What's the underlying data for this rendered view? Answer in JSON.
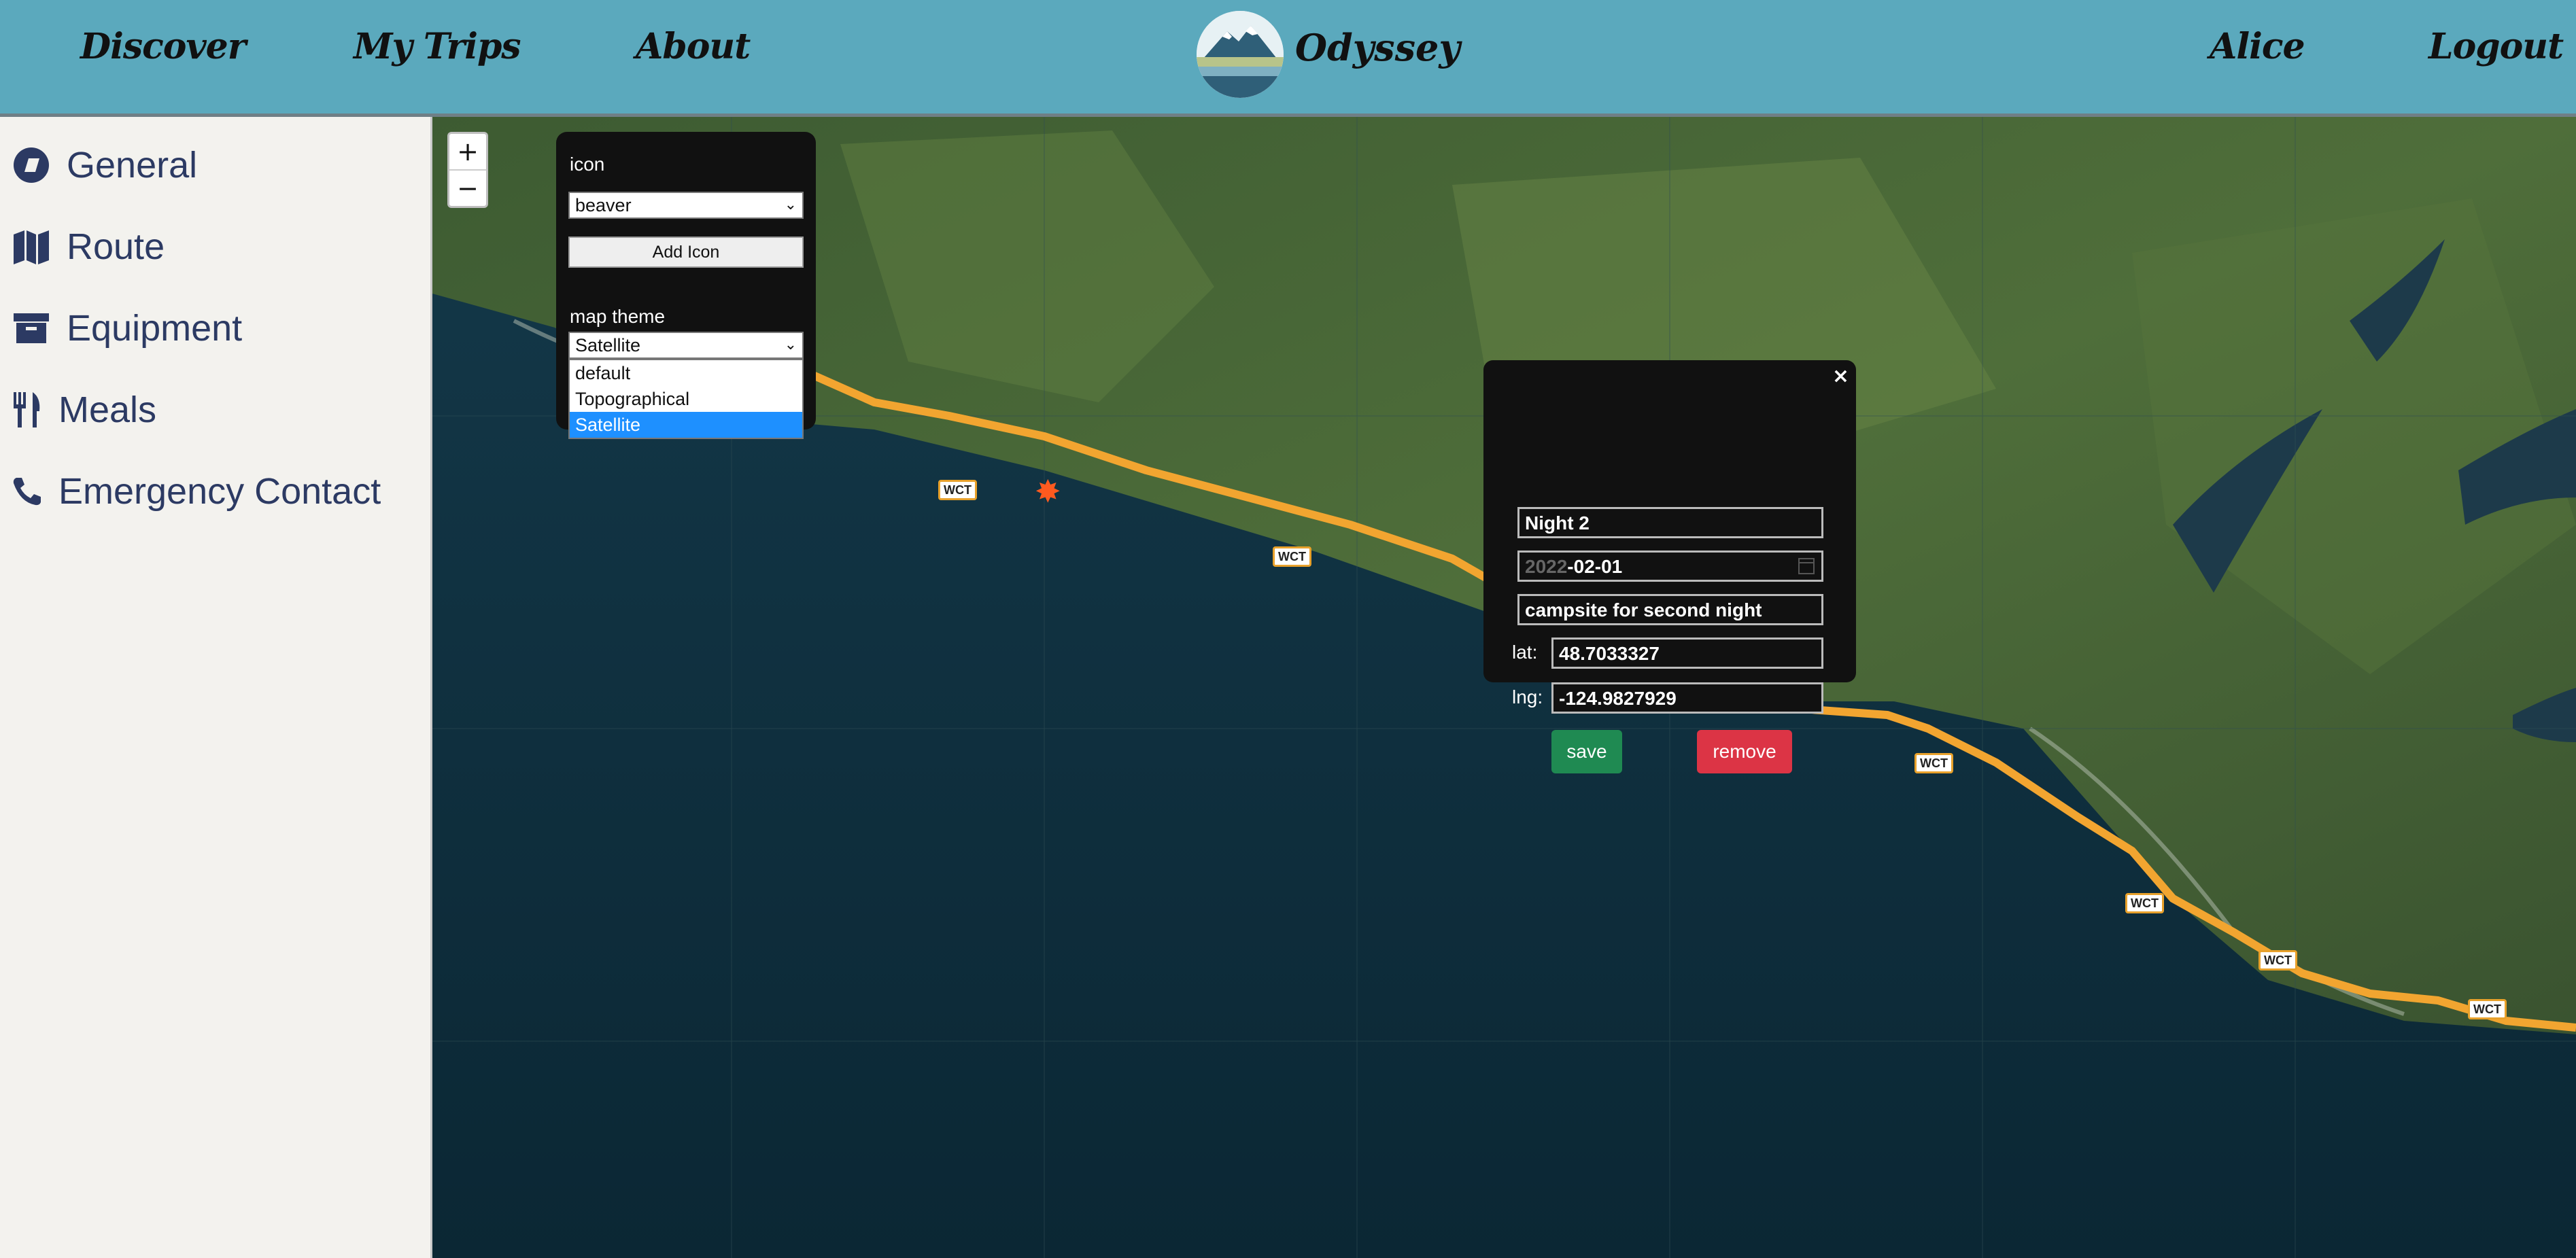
{
  "header": {
    "nav": [
      "Discover",
      "My Trips",
      "About"
    ],
    "logo_title": "Odyssey",
    "user": "Alice",
    "logout": "Logout"
  },
  "sidebar": {
    "items": [
      {
        "label": "General",
        "icon": "compass-icon"
      },
      {
        "label": "Route",
        "icon": "map-icon"
      },
      {
        "label": "Equipment",
        "icon": "archive-box-icon"
      },
      {
        "label": "Meals",
        "icon": "utensils-icon"
      },
      {
        "label": "Emergency Contact",
        "icon": "phone-icon"
      }
    ]
  },
  "map": {
    "zoom_in": "+",
    "zoom_out": "−",
    "controls": {
      "icon_label": "icon",
      "icon_value": "beaver",
      "add_icon": "Add Icon",
      "theme_label": "map theme",
      "theme_value": "Satellite",
      "theme_options": [
        "default",
        "Topographical",
        "Satellite"
      ],
      "theme_selected_index": 2
    },
    "route_label": "WCT",
    "popup": {
      "close": "×",
      "name": "Night 2",
      "date_year": "2022",
      "date_rest": "-02-01",
      "description": "campsite for second night",
      "lat_label": "lat:",
      "lat": "48.7033327",
      "lng_label": "lng:",
      "lng": "-124.9827929",
      "save": "save",
      "remove": "remove"
    },
    "colors": {
      "route": "#f2a530",
      "save": "#1f8a52",
      "remove": "#dc3445",
      "header": "#5ba9bd"
    }
  }
}
